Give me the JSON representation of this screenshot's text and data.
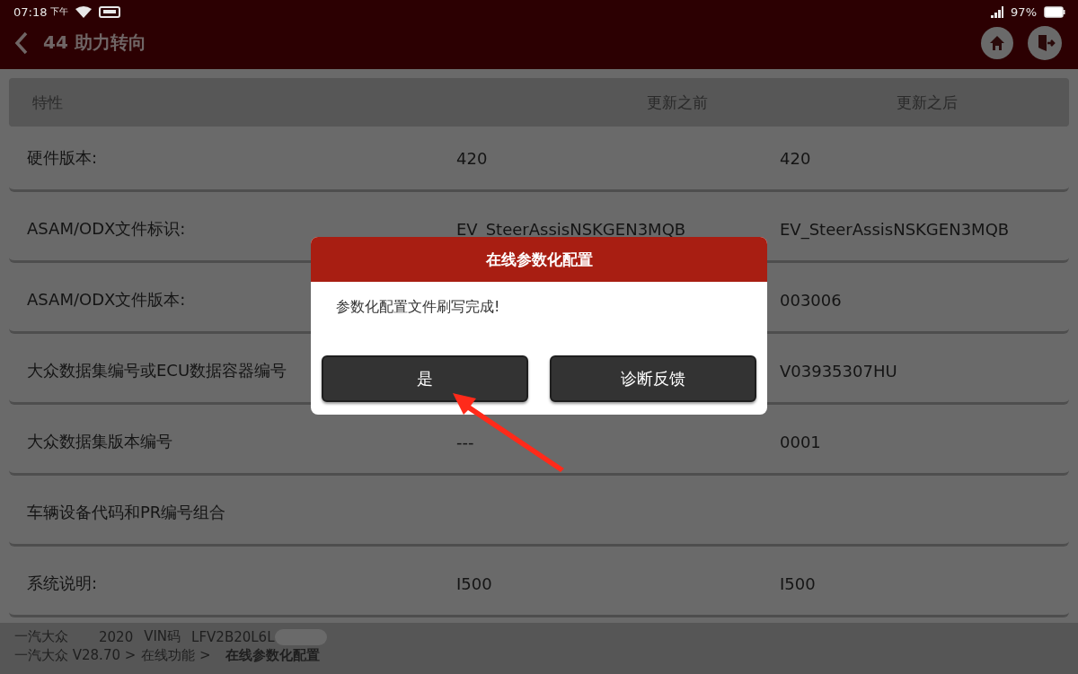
{
  "status_bar": {
    "time": "07:18",
    "period": "下午",
    "battery": "97%"
  },
  "header": {
    "title": "44 助力转向"
  },
  "table": {
    "columns": [
      "特性",
      "更新之前",
      "更新之后"
    ],
    "rows": [
      {
        "label": "硬件版本:",
        "before": "420",
        "after": "420"
      },
      {
        "label": "ASAM/ODX文件标识:",
        "before": "EV_SteerAssisNSKGEN3MQB",
        "after": "EV_SteerAssisNSKGEN3MQB"
      },
      {
        "label": "ASAM/ODX文件版本:",
        "after": "003006"
      },
      {
        "label": "大众数据集编号或ECU数据容器编号",
        "after": "V03935307HU"
      },
      {
        "label": "大众数据集版本编号",
        "before": "---",
        "after": "0001"
      },
      {
        "label": "车辆设备代码和PR编号组合"
      },
      {
        "label": "系统说明:",
        "before": "I500",
        "after": "I500"
      }
    ]
  },
  "dialog": {
    "title": "在线参数化配置",
    "message": "参数化配置文件刷写完成!",
    "buttons": [
      "是",
      "诊断反馈"
    ]
  },
  "footer": {
    "make": "一汽大众",
    "year": "2020",
    "vin_label": "VIN码",
    "vin": "LFV2B20L6L",
    "breadcrumb": [
      "一汽大众 V28.70 >",
      "在线功能 >",
      "在线参数化配置"
    ]
  }
}
